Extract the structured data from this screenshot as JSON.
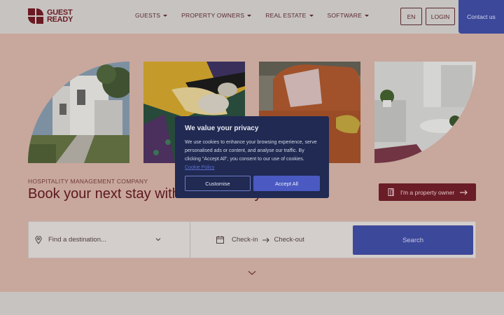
{
  "header": {
    "logo_line1": "GUEST",
    "logo_line2": "READY",
    "nav": [
      {
        "label": "GUESTS"
      },
      {
        "label": "PROPERTY OWNERS"
      },
      {
        "label": "REAL ESTATE"
      },
      {
        "label": "SOFTWARE"
      }
    ],
    "lang_label": "EN",
    "login_label": "LOGIN",
    "contact_label": "Contact us"
  },
  "hero": {
    "kicker": "HOSPITALITY MANAGEMENT COMPANY",
    "headline": "Book your next stay with GuestReady",
    "owner_button": "I'm a property owner"
  },
  "search": {
    "destination_placeholder": "Find a destination...",
    "checkin_label": "Check-in",
    "checkout_label": "Check-out",
    "button_label": "Search"
  },
  "cookie_modal": {
    "title": "We value your privacy",
    "body": "We use cookies to enhance your browsing experience, serve personalised ads or content, and analyse our traffic. By clicking \"Accept All\", you consent to our use of cookies.",
    "policy_link": "Cookie Policy",
    "customise_label": "Customise",
    "accept_label": "Accept All"
  },
  "colors": {
    "brand_primary": "#3c489a",
    "brand_burgundy": "#6a1d27",
    "overlay_bg": "#c8a79c",
    "modal_bg": "#202a52"
  }
}
